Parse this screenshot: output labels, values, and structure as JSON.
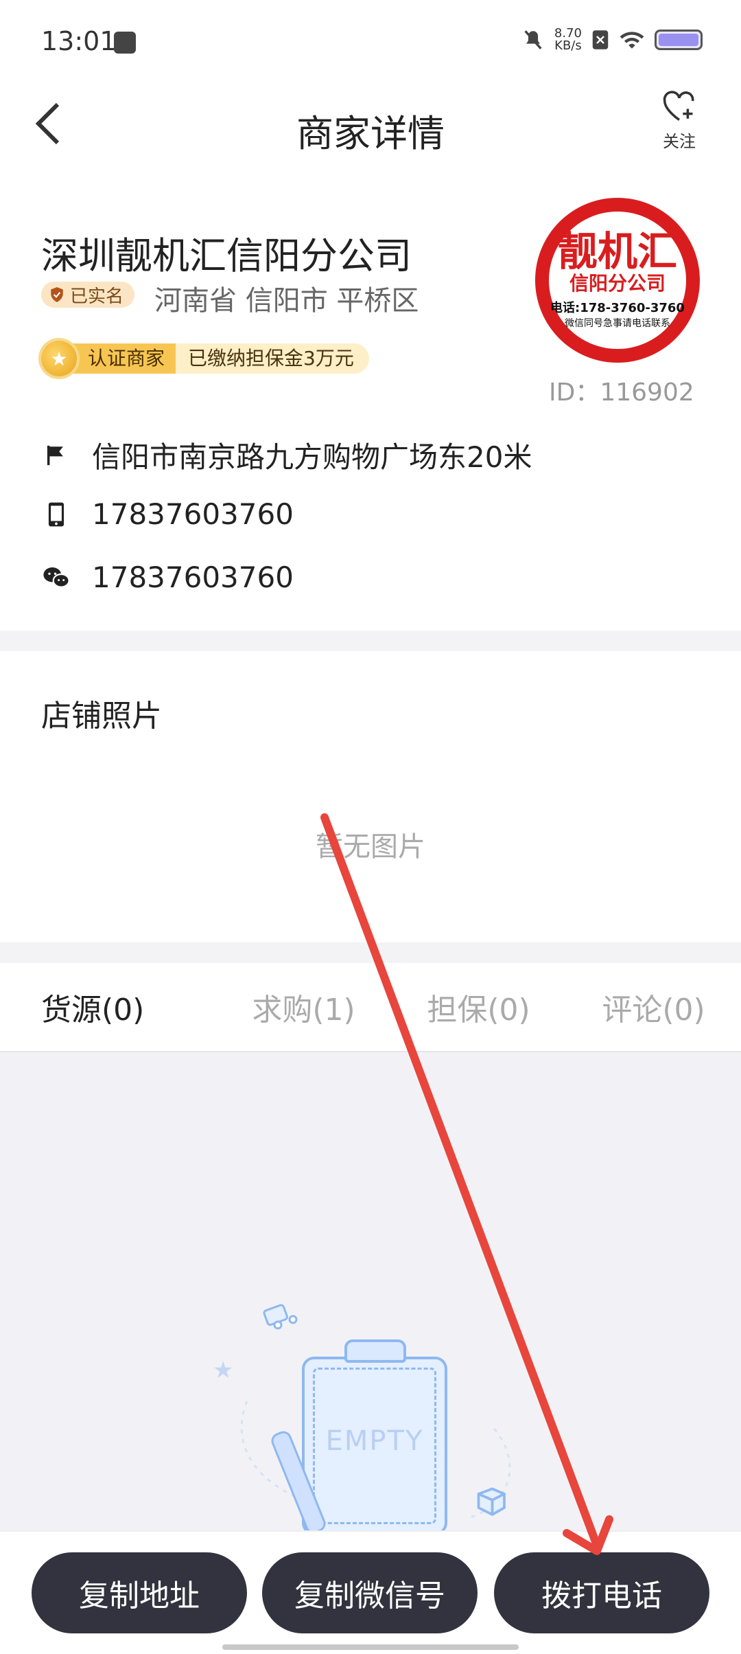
{
  "status_bar": {
    "time": "13:01",
    "net_speed_value": "8.70",
    "net_speed_unit": "KB/s"
  },
  "header": {
    "title": "商家详情",
    "follow_label": "关注"
  },
  "merchant": {
    "name": "深圳靓机汇信阳分公司",
    "verified_label": "已实名",
    "region": "河南省 信阳市 平桥区",
    "cert_label": "认证商家",
    "cert_text": "已缴纳担保金3万元",
    "id_text": "ID：116902",
    "logo": {
      "line1": "靓机汇",
      "line2": "信阳分公司",
      "line3": "电话:178-3760-3760",
      "line4": "微信同号急事请电话联系"
    }
  },
  "info": {
    "address": "信阳市南京路九方购物广场东20米",
    "phone": "17837603760",
    "wechat": "17837603760"
  },
  "photos": {
    "title": "店铺照片",
    "empty_text": "暂无图片"
  },
  "tabs": [
    {
      "label": "货源(0)"
    },
    {
      "label": "求购(1)"
    },
    {
      "label": "担保(0)"
    },
    {
      "label": "评论(0)"
    }
  ],
  "empty_state": {
    "text": "EMPTY"
  },
  "bottom": {
    "copy_address": "复制地址",
    "copy_wechat": "复制微信号",
    "call": "拨打电话"
  },
  "colors": {
    "accent_red": "#e8453c",
    "button_dark": "#33333f",
    "logo_red": "#d91d1f"
  }
}
